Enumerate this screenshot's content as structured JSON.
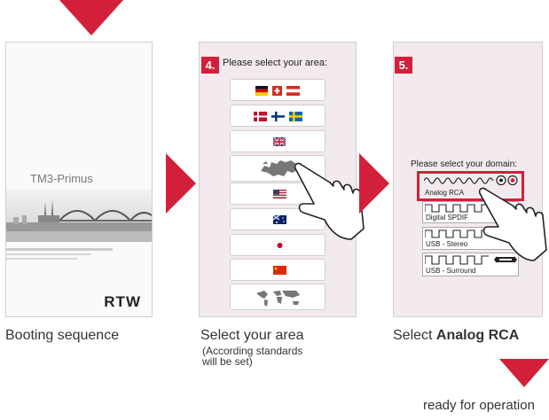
{
  "screen1": {
    "device_name": "TM3-Primus",
    "logo": "RTW",
    "caption": "Booting sequence"
  },
  "screen2": {
    "step": "4.",
    "prompt": "Please select your area:",
    "caption": "Select your area",
    "note_line1": "(According standards",
    "note_line2": "will be set)",
    "areas": [
      {
        "icon": "flags-de-ch-at-icon"
      },
      {
        "icon": "flags-dk-fi-se-icon"
      },
      {
        "icon": "flag-uk-icon"
      },
      {
        "icon": "map-europe-icon"
      },
      {
        "icon": "flag-us-icon"
      },
      {
        "icon": "flag-au-icon"
      },
      {
        "icon": "flag-jp-icon"
      },
      {
        "icon": "flag-cn-icon"
      },
      {
        "icon": "map-world-icon"
      }
    ]
  },
  "screen3": {
    "step": "5.",
    "prompt": "Please select your domain:",
    "domains": [
      "Analog RCA",
      "Digital SPDIF",
      "USB - Stereo",
      "USB - Surround"
    ],
    "caption_prefix": "Select ",
    "caption_bold": "Analog RCA"
  },
  "final": {
    "caption": "ready for operation"
  },
  "colors": {
    "accent": "#d3203a",
    "panel_bg": "#f2eaee",
    "border": "#cfcfcf"
  }
}
